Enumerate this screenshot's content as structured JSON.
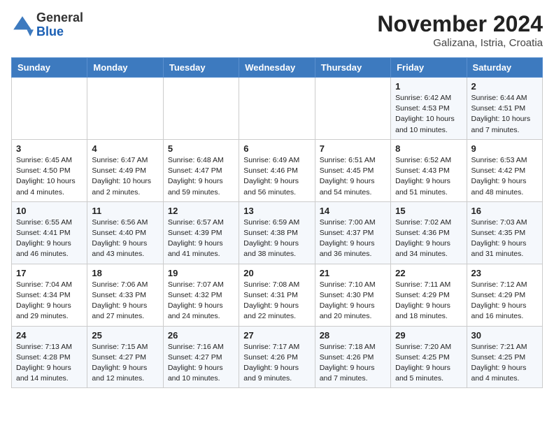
{
  "header": {
    "logo_general": "General",
    "logo_blue": "Blue",
    "month_title": "November 2024",
    "location": "Galizana, Istria, Croatia"
  },
  "weekdays": [
    "Sunday",
    "Monday",
    "Tuesday",
    "Wednesday",
    "Thursday",
    "Friday",
    "Saturday"
  ],
  "weeks": [
    [
      {
        "day": "",
        "info": ""
      },
      {
        "day": "",
        "info": ""
      },
      {
        "day": "",
        "info": ""
      },
      {
        "day": "",
        "info": ""
      },
      {
        "day": "",
        "info": ""
      },
      {
        "day": "1",
        "info": "Sunrise: 6:42 AM\nSunset: 4:53 PM\nDaylight: 10 hours and 10 minutes."
      },
      {
        "day": "2",
        "info": "Sunrise: 6:44 AM\nSunset: 4:51 PM\nDaylight: 10 hours and 7 minutes."
      }
    ],
    [
      {
        "day": "3",
        "info": "Sunrise: 6:45 AM\nSunset: 4:50 PM\nDaylight: 10 hours and 4 minutes."
      },
      {
        "day": "4",
        "info": "Sunrise: 6:47 AM\nSunset: 4:49 PM\nDaylight: 10 hours and 2 minutes."
      },
      {
        "day": "5",
        "info": "Sunrise: 6:48 AM\nSunset: 4:47 PM\nDaylight: 9 hours and 59 minutes."
      },
      {
        "day": "6",
        "info": "Sunrise: 6:49 AM\nSunset: 4:46 PM\nDaylight: 9 hours and 56 minutes."
      },
      {
        "day": "7",
        "info": "Sunrise: 6:51 AM\nSunset: 4:45 PM\nDaylight: 9 hours and 54 minutes."
      },
      {
        "day": "8",
        "info": "Sunrise: 6:52 AM\nSunset: 4:43 PM\nDaylight: 9 hours and 51 minutes."
      },
      {
        "day": "9",
        "info": "Sunrise: 6:53 AM\nSunset: 4:42 PM\nDaylight: 9 hours and 48 minutes."
      }
    ],
    [
      {
        "day": "10",
        "info": "Sunrise: 6:55 AM\nSunset: 4:41 PM\nDaylight: 9 hours and 46 minutes."
      },
      {
        "day": "11",
        "info": "Sunrise: 6:56 AM\nSunset: 4:40 PM\nDaylight: 9 hours and 43 minutes."
      },
      {
        "day": "12",
        "info": "Sunrise: 6:57 AM\nSunset: 4:39 PM\nDaylight: 9 hours and 41 minutes."
      },
      {
        "day": "13",
        "info": "Sunrise: 6:59 AM\nSunset: 4:38 PM\nDaylight: 9 hours and 38 minutes."
      },
      {
        "day": "14",
        "info": "Sunrise: 7:00 AM\nSunset: 4:37 PM\nDaylight: 9 hours and 36 minutes."
      },
      {
        "day": "15",
        "info": "Sunrise: 7:02 AM\nSunset: 4:36 PM\nDaylight: 9 hours and 34 minutes."
      },
      {
        "day": "16",
        "info": "Sunrise: 7:03 AM\nSunset: 4:35 PM\nDaylight: 9 hours and 31 minutes."
      }
    ],
    [
      {
        "day": "17",
        "info": "Sunrise: 7:04 AM\nSunset: 4:34 PM\nDaylight: 9 hours and 29 minutes."
      },
      {
        "day": "18",
        "info": "Sunrise: 7:06 AM\nSunset: 4:33 PM\nDaylight: 9 hours and 27 minutes."
      },
      {
        "day": "19",
        "info": "Sunrise: 7:07 AM\nSunset: 4:32 PM\nDaylight: 9 hours and 24 minutes."
      },
      {
        "day": "20",
        "info": "Sunrise: 7:08 AM\nSunset: 4:31 PM\nDaylight: 9 hours and 22 minutes."
      },
      {
        "day": "21",
        "info": "Sunrise: 7:10 AM\nSunset: 4:30 PM\nDaylight: 9 hours and 20 minutes."
      },
      {
        "day": "22",
        "info": "Sunrise: 7:11 AM\nSunset: 4:29 PM\nDaylight: 9 hours and 18 minutes."
      },
      {
        "day": "23",
        "info": "Sunrise: 7:12 AM\nSunset: 4:29 PM\nDaylight: 9 hours and 16 minutes."
      }
    ],
    [
      {
        "day": "24",
        "info": "Sunrise: 7:13 AM\nSunset: 4:28 PM\nDaylight: 9 hours and 14 minutes."
      },
      {
        "day": "25",
        "info": "Sunrise: 7:15 AM\nSunset: 4:27 PM\nDaylight: 9 hours and 12 minutes."
      },
      {
        "day": "26",
        "info": "Sunrise: 7:16 AM\nSunset: 4:27 PM\nDaylight: 9 hours and 10 minutes."
      },
      {
        "day": "27",
        "info": "Sunrise: 7:17 AM\nSunset: 4:26 PM\nDaylight: 9 hours and 9 minutes."
      },
      {
        "day": "28",
        "info": "Sunrise: 7:18 AM\nSunset: 4:26 PM\nDaylight: 9 hours and 7 minutes."
      },
      {
        "day": "29",
        "info": "Sunrise: 7:20 AM\nSunset: 4:25 PM\nDaylight: 9 hours and 5 minutes."
      },
      {
        "day": "30",
        "info": "Sunrise: 7:21 AM\nSunset: 4:25 PM\nDaylight: 9 hours and 4 minutes."
      }
    ]
  ]
}
